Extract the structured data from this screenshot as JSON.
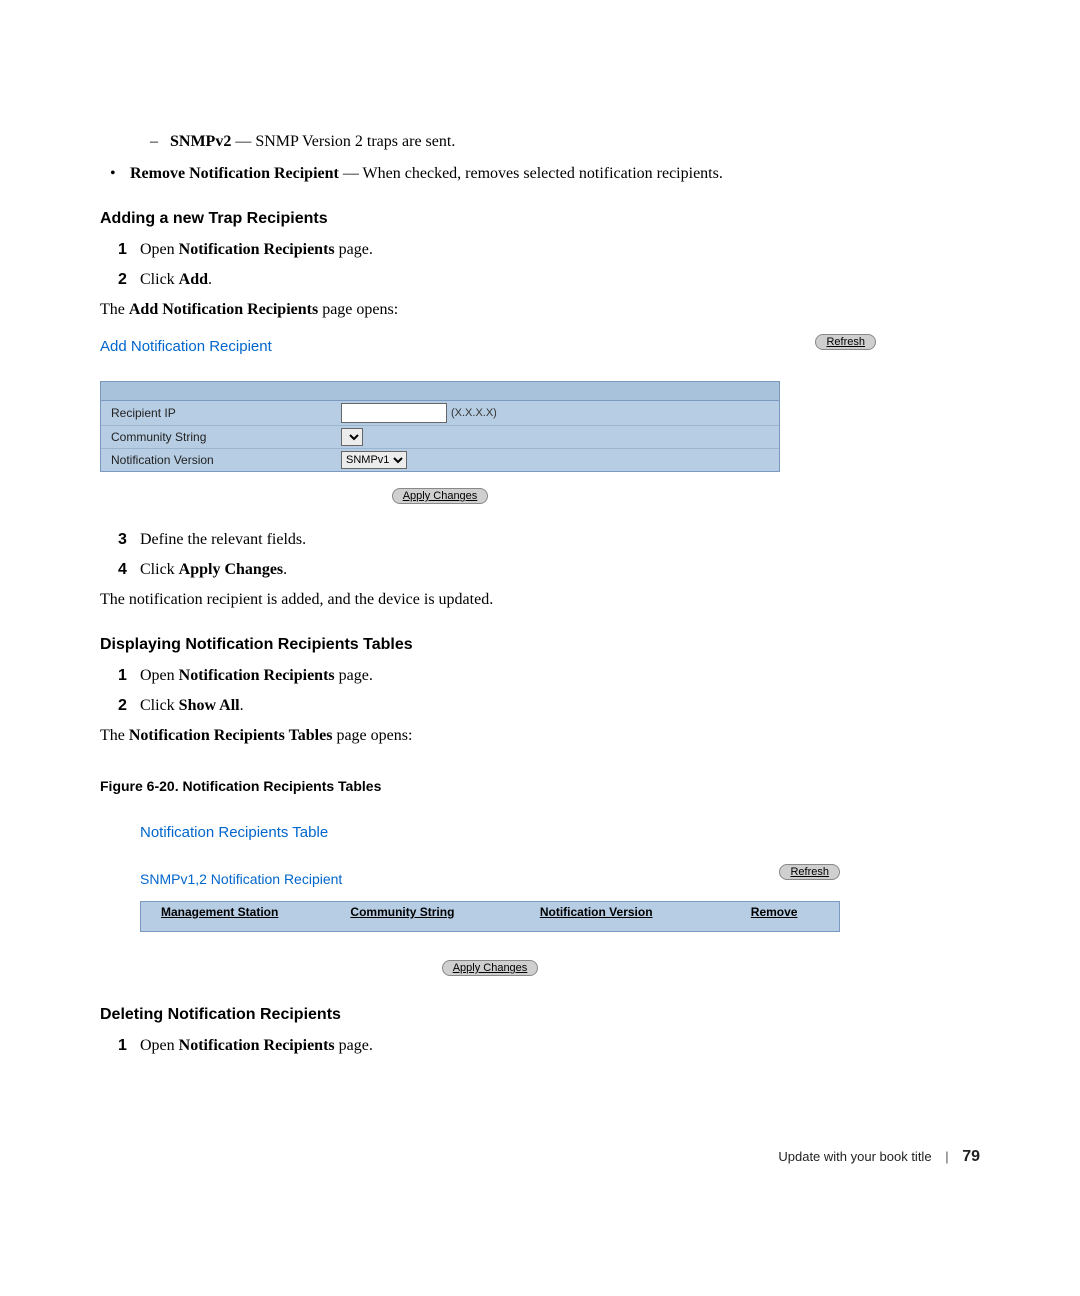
{
  "intro": {
    "snmpv2_term": "SNMPv2",
    "snmpv2_desc": " — SNMP Version 2 traps are sent.",
    "remove_term": "Remove Notification Recipient",
    "remove_desc": " — When checked, removes selected notification recipients."
  },
  "sectionA": {
    "heading": "Adding a new Trap Recipients",
    "steps_open": "Open ",
    "steps_open_bold": "Notification Recipients",
    "steps_open_tail": " page.",
    "steps_click": "Click ",
    "steps_click_bold": "Add",
    "steps_click_tail": ".",
    "result_pre": "The ",
    "result_bold": "Add Notification Recipients",
    "result_tail": " page opens:"
  },
  "shot1": {
    "refresh": "Refresh",
    "title": "Add Notification Recipient",
    "row1_label": "Recipient IP",
    "row1_hint": "(X.X.X.X)",
    "row2_label": "Community String",
    "row3_label": "Notification Version",
    "row3_select": "SNMPv1",
    "apply": "Apply Changes"
  },
  "sectionA2": {
    "s3": "Define the relevant fields.",
    "s4_pre": "Click ",
    "s4_bold": "Apply Changes",
    "s4_tail": ".",
    "result": "The notification recipient is added, and the device is updated."
  },
  "sectionB": {
    "heading": "Displaying Notification Recipients Tables",
    "s1_pre": "Open ",
    "s1_bold": "Notification Recipients",
    "s1_tail": " page.",
    "s2_pre": "Click ",
    "s2_bold": "Show All",
    "s2_tail": ".",
    "result_pre": "The ",
    "result_bold": "Notification Recipients Tables",
    "result_tail": " page opens:"
  },
  "fig": {
    "caption": "Figure 6-20.    Notification Recipients Tables"
  },
  "shot2": {
    "title": "Notification Recipients Table",
    "refresh": "Refresh",
    "subtitle": "SNMPv1,2 Notification Recipient",
    "col1": "Management Station",
    "col2": "Community String",
    "col3": "Notification Version",
    "col4": "Remove",
    "apply": "Apply Changes"
  },
  "sectionC": {
    "heading": "Deleting Notification Recipients",
    "s1_pre": "Open ",
    "s1_bold": "Notification Recipients",
    "s1_tail": " page."
  },
  "footer": {
    "book": "Update with your book title",
    "page": "79"
  }
}
